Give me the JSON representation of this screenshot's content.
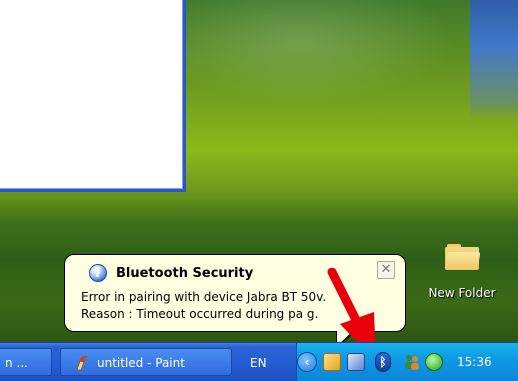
{
  "desktop": {
    "icons": [
      {
        "label": "New Folder",
        "icon": "folder-icon"
      }
    ]
  },
  "balloon": {
    "icon": "info-icon",
    "title": "Bluetooth Security",
    "line1": "Error in pairing with device Jabra BT  50v.",
    "line2": "Reason : Timeout occurred during pa   g.",
    "close_label": "✕"
  },
  "taskbar": {
    "left_button_label": "n ...",
    "paint_button_label": "untitled - Paint",
    "language": "EN",
    "chevron": "‹",
    "tray_icons": [
      "clock-app-icon",
      "network-icon",
      "bluetooth-icon",
      "users-icon",
      "sync-icon"
    ],
    "bluetooth_glyph": "ᛒ",
    "time": "15:36"
  },
  "colors": {
    "taskbar_blue": "#245ed4",
    "tray_blue": "#0f9ae5",
    "balloon_bg": "#ffffe1",
    "annotation_arrow": "#e8000a"
  }
}
